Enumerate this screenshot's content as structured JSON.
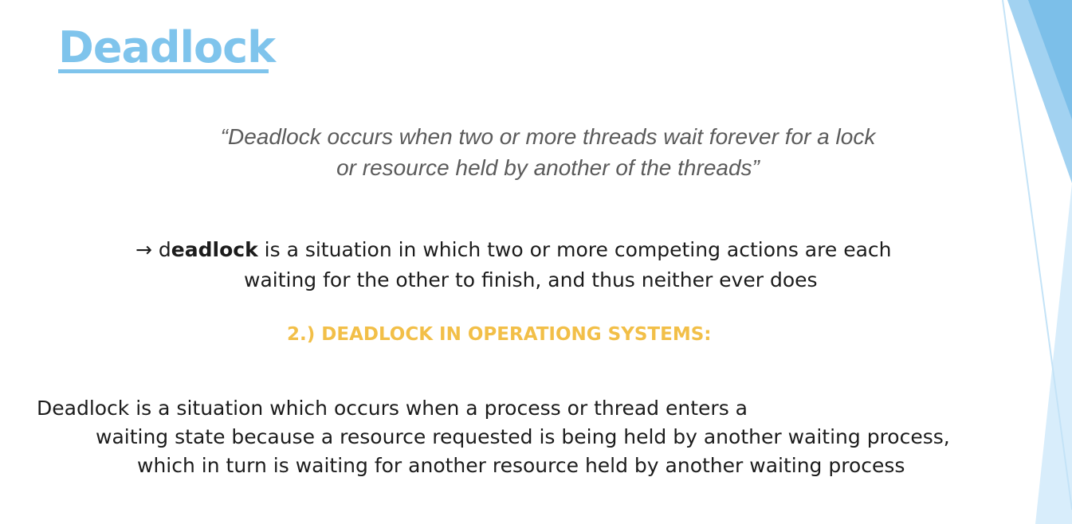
{
  "slide": {
    "title": "Deadlock",
    "quote": {
      "line1": "“Deadlock occurs when two or more threads wait forever for a lock",
      "line2": "or resource held by another of the threads”"
    },
    "definition": {
      "arrow": "→",
      "keyword_prefix": "d",
      "keyword_bold": "eadlock",
      "line1_rest": " is a situation in which two or more competing actions are each",
      "line2": "waiting for the other to finish, and thus neither ever does"
    },
    "section_heading": "2.) DEADLOCK IN OPERATIONG SYSTEMS:",
    "paragraph": {
      "line1": "Deadlock is a situation which occurs when a process or thread enters a",
      "line2": "waiting state because a resource requested is being held by another waiting process,",
      "line3": "which in turn is waiting for another resource held by another waiting process"
    }
  },
  "colors": {
    "title": "#7fc4ec",
    "heading": "#f2bf48",
    "quote": "#5b5b5b",
    "body_text": "#1c1c1c",
    "decor_light": "#d4ebfa",
    "decor_mid": "#9fd0f0",
    "decor_dark": "#78bde8"
  }
}
